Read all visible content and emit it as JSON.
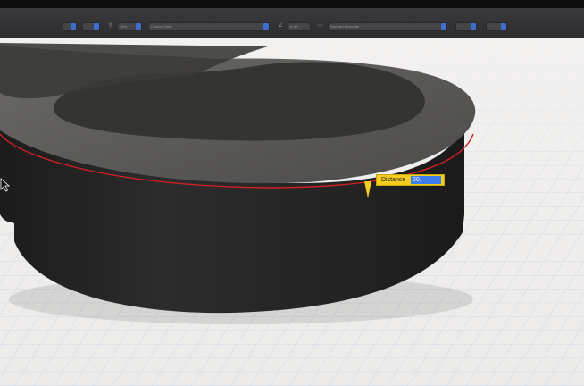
{
  "toolbar": {
    "zoom_value": "36%",
    "view_select": "Custom View",
    "angle_value": "0.00°",
    "plane_select": "Normal Horizontal"
  },
  "dimension_input": {
    "label": "Distance",
    "value": "20."
  },
  "icons": {
    "zoom": "magnifier-icon",
    "angle": "angle-icon",
    "plane": "plane-icon",
    "cursor": "pointer-cursor-icon"
  },
  "colors": {
    "toolbar_bg": "#333336",
    "dropdown_accent": "#3d6fd0",
    "model_body": "#262627",
    "model_top_face": "#5b5a58",
    "edge_highlight": "#d01f25",
    "dimension_box": "#f4cd1e",
    "dimension_field": "#3d7ef0",
    "grid_line": "#cdd6e6"
  }
}
